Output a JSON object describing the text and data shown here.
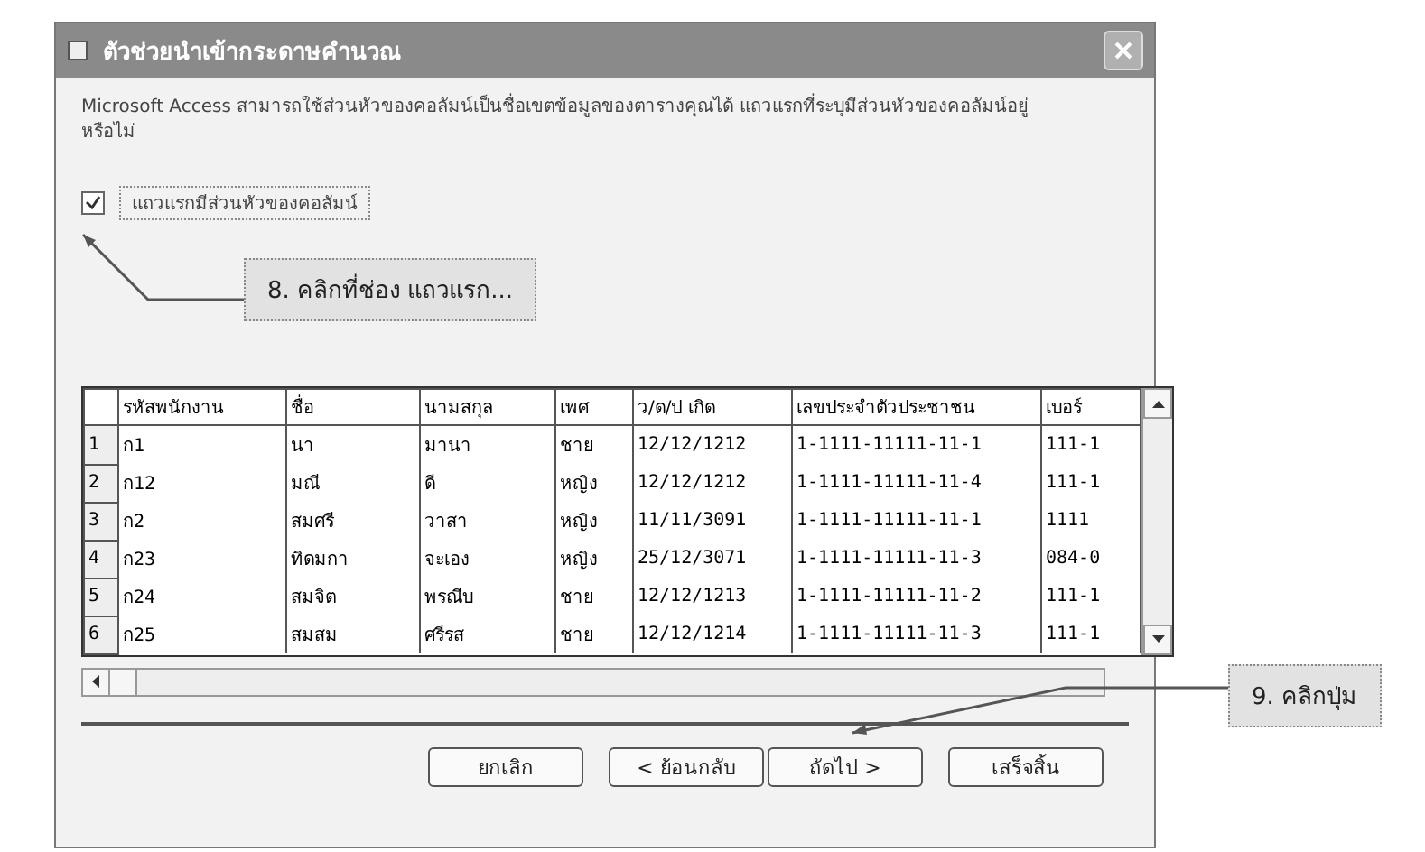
{
  "window": {
    "title": "ตัวช่วยนำเข้ากระดาษคำนวณ"
  },
  "intro": "Microsoft Access สามารถใช้ส่วนหัวของคอลัมน์เป็นชื่อเขตข้อมูลของตารางคุณได้ แถวแรกที่ระบุมีส่วนหัวของคอลัมน์อยู่หรือไม่",
  "first_row_checkbox": {
    "label": "แถวแรกมีส่วนหัวของคอลัมน์",
    "checked": true
  },
  "table": {
    "columns": [
      "รหัสพนักงาน",
      "ชื่อ",
      "นามสกุล",
      "เพศ",
      "ว/ด/ป เกิด",
      "เลขประจำตัวประชาชน",
      "เบอร์"
    ],
    "rows": [
      {
        "number": "1",
        "cells": [
          "ก1",
          "นา",
          "มานา",
          "ชาย",
          "12/12/1212",
          "1-1111-11111-11-1",
          "111-1"
        ]
      },
      {
        "number": "2",
        "cells": [
          "ก12",
          "มณี",
          "ดี",
          "หญิง",
          "12/12/1212",
          "1-1111-11111-11-4",
          "111-1"
        ]
      },
      {
        "number": "3",
        "cells": [
          "ก2",
          "สมศรี",
          "วาสา",
          "หญิง",
          "11/11/3091",
          "1-1111-11111-11-1",
          "1111"
        ]
      },
      {
        "number": "4",
        "cells": [
          "ก23",
          "ทิดมกา",
          "จะเอง",
          "หญิง",
          "25/12/3071",
          "1-1111-11111-11-3",
          "084-0"
        ]
      },
      {
        "number": "5",
        "cells": [
          "ก24",
          "สมจิต",
          "พรณีบ",
          "ชาย",
          "12/12/1213",
          "1-1111-11111-11-2",
          "111-1"
        ]
      },
      {
        "number": "6",
        "cells": [
          "ก25",
          "สมสม",
          "ศรีรส",
          "ชาย",
          "12/12/1214",
          "1-1111-11111-11-3",
          "111-1"
        ]
      }
    ]
  },
  "buttons": [
    "ยกเลิก",
    "< ย้อนกลับ",
    "ถัดไป >",
    "เสร็จสิ้น"
  ],
  "callouts": [
    {
      "text": "8. คลิกที่ช่อง แถวแรก..."
    },
    {
      "text": "9. คลิกปุ่ม"
    }
  ]
}
